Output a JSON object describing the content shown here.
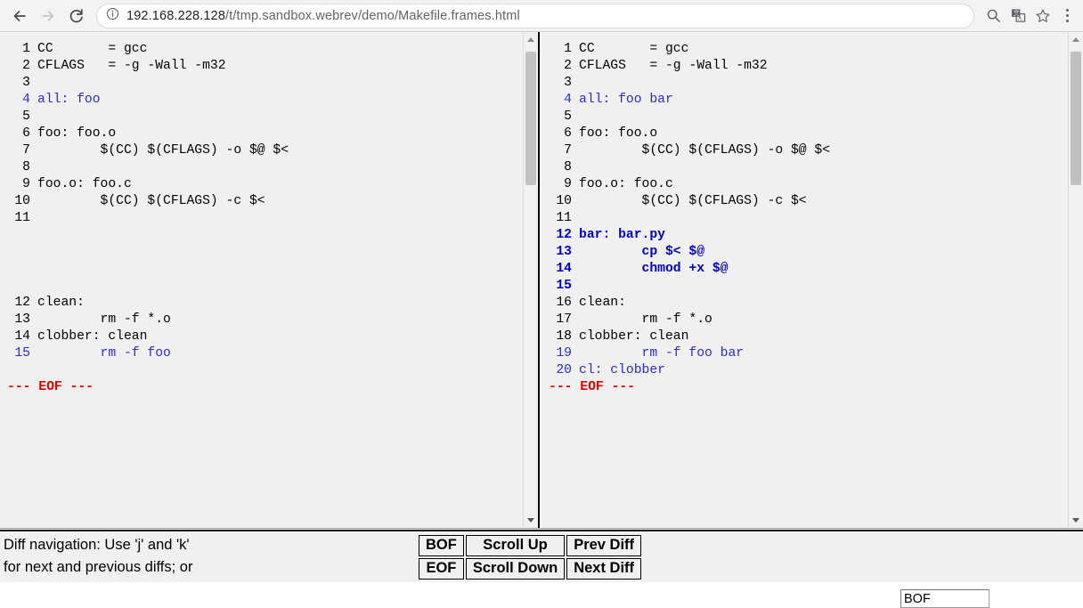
{
  "browser": {
    "back_icon": "arrow-left-icon",
    "forward_icon": "arrow-right-icon",
    "reload_icon": "reload-icon",
    "info_icon": "info-circle-icon",
    "url_host": "192.168.228.128",
    "url_path": "/t/tmp.sandbox.webrev/demo/Makefile.frames.html",
    "url_full": "192.168.228.128/t/tmp.sandbox.webrev/demo/Makefile.frames.html",
    "omni_icons": [
      "search-icon",
      "translate-icon",
      "bookmark-star-icon"
    ],
    "menu_icon": "kebab-menu-icon"
  },
  "left_pane": {
    "name": "old-file-pane",
    "lines": [
      {
        "n": "1",
        "text": "CC       = gcc",
        "style": "same"
      },
      {
        "n": "2",
        "text": "CFLAGS   = -g -Wall -m32",
        "style": "same"
      },
      {
        "n": "3",
        "text": "",
        "style": "same"
      },
      {
        "n": "4",
        "text": "all: foo",
        "style": "ins"
      },
      {
        "n": "5",
        "text": "",
        "style": "same"
      },
      {
        "n": "6",
        "text": "foo: foo.o",
        "style": "same"
      },
      {
        "n": "7",
        "text": "        $(CC) $(CFLAGS) -o $@ $<",
        "style": "same"
      },
      {
        "n": "8",
        "text": "",
        "style": "same"
      },
      {
        "n": "9",
        "text": "foo.o: foo.c",
        "style": "same"
      },
      {
        "n": "10",
        "text": "        $(CC) $(CFLAGS) -c $<",
        "style": "same"
      },
      {
        "n": "11",
        "text": "",
        "style": "same"
      },
      {
        "n": "",
        "text": "",
        "style": "same"
      },
      {
        "n": "",
        "text": "",
        "style": "same"
      },
      {
        "n": "",
        "text": "",
        "style": "same"
      },
      {
        "n": "",
        "text": "",
        "style": "same"
      },
      {
        "n": "12",
        "text": "clean:",
        "style": "same"
      },
      {
        "n": "13",
        "text": "        rm -f *.o",
        "style": "same"
      },
      {
        "n": "14",
        "text": "clobber: clean",
        "style": "same"
      },
      {
        "n": "15",
        "text": "        rm -f foo",
        "style": "ins"
      }
    ],
    "eof_marker": "--- EOF ---"
  },
  "right_pane": {
    "name": "new-file-pane",
    "lines": [
      {
        "n": "1",
        "text": "CC       = gcc",
        "style": "same"
      },
      {
        "n": "2",
        "text": "CFLAGS   = -g -Wall -m32",
        "style": "same"
      },
      {
        "n": "3",
        "text": "",
        "style": "same"
      },
      {
        "n": "4",
        "text": "all: foo bar",
        "style": "ins"
      },
      {
        "n": "5",
        "text": "",
        "style": "same"
      },
      {
        "n": "6",
        "text": "foo: foo.o",
        "style": "same"
      },
      {
        "n": "7",
        "text": "        $(CC) $(CFLAGS) -o $@ $<",
        "style": "same"
      },
      {
        "n": "8",
        "text": "",
        "style": "same"
      },
      {
        "n": "9",
        "text": "foo.o: foo.c",
        "style": "same"
      },
      {
        "n": "10",
        "text": "        $(CC) $(CFLAGS) -c $<",
        "style": "same"
      },
      {
        "n": "11",
        "text": "",
        "style": "same"
      },
      {
        "n": "12",
        "text": "bar: bar.py",
        "style": "new"
      },
      {
        "n": "13",
        "text": "        cp $< $@",
        "style": "new"
      },
      {
        "n": "14",
        "text": "        chmod +x $@",
        "style": "new"
      },
      {
        "n": "15",
        "text": "",
        "style": "new"
      },
      {
        "n": "16",
        "text": "clean:",
        "style": "same"
      },
      {
        "n": "17",
        "text": "        rm -f *.o",
        "style": "same"
      },
      {
        "n": "18",
        "text": "clobber: clean",
        "style": "same"
      },
      {
        "n": "19",
        "text": "        rm -f foo bar",
        "style": "ins"
      },
      {
        "n": "20",
        "text": "cl: clobber",
        "style": "ins"
      }
    ],
    "eof_marker": "--- EOF ---"
  },
  "nav_bar": {
    "help_line_1": "Diff navigation: Use 'j' and 'k'",
    "help_line_2": "for next and previous diffs; or",
    "buttons": [
      [
        "BOF",
        "Scroll Up",
        "Prev Diff"
      ],
      [
        "EOF",
        "Scroll Down",
        "Next Diff"
      ]
    ],
    "position_input_value": "BOF",
    "position_input_placeholder": ""
  },
  "colors": {
    "insert_blue": "#2b2bd0",
    "new_blue": "#0000c8",
    "eof_red": "#e00000",
    "pane_bg": "#f0f0f0",
    "chrome_bg": "#f1f3f4"
  }
}
